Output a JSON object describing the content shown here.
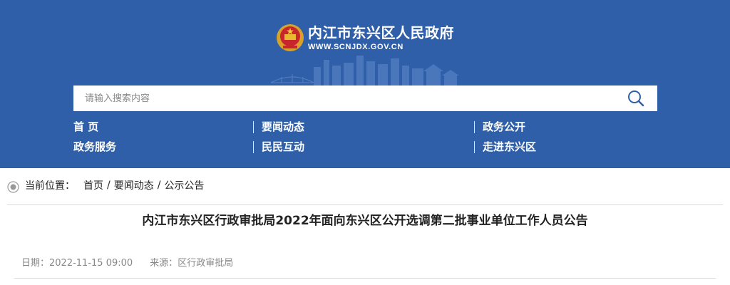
{
  "site": {
    "title": "内江市东兴区人民政府",
    "domain": "WWW.SCNJDX.GOV.CN"
  },
  "search": {
    "placeholder": "请输入搜索内容",
    "icon": "search-icon"
  },
  "nav": {
    "items": [
      {
        "label": "首 页"
      },
      {
        "label": "要闻动态"
      },
      {
        "label": "政务公开"
      },
      {
        "label": "政务服务"
      },
      {
        "label": "民民互动"
      },
      {
        "label": "走进东兴区"
      }
    ]
  },
  "breadcrumb": {
    "label": "当前位置：",
    "items": [
      "首页",
      "要闻动态",
      "公示公告"
    ],
    "separator": "/"
  },
  "article": {
    "title": "内江市东兴区行政审批局2022年面向东兴区公开选调第二批事业单位工作人员公告",
    "date_label": "日期：",
    "date": "2022-11-15 09:00",
    "source_label": "来源：",
    "source": "区行政审批局"
  },
  "colors": {
    "header_bg": "#2f5fa8",
    "text": "#222222",
    "meta": "#888888"
  }
}
